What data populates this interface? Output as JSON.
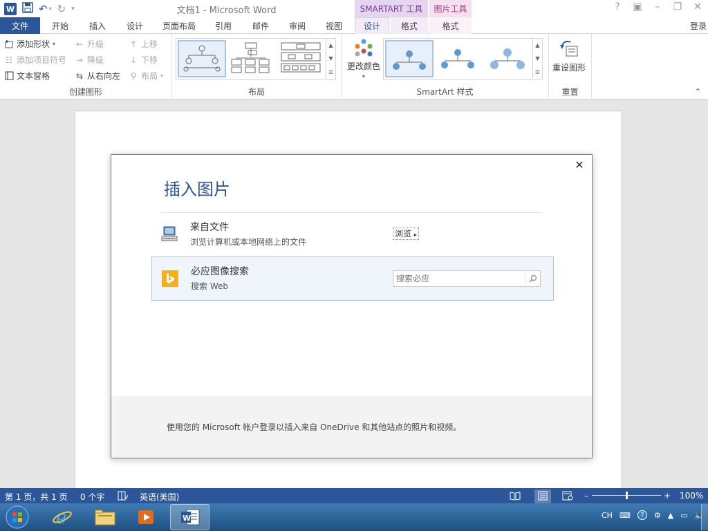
{
  "window": {
    "doc_title": "文档1 - Microsoft Word",
    "app_icon": "W"
  },
  "context_tools": {
    "smartart": "SMARTART 工具",
    "picture": "图片工具"
  },
  "tabs": [
    "文件",
    "开始",
    "插入",
    "设计",
    "页面布局",
    "引用",
    "邮件",
    "审阅",
    "视图",
    "设计",
    "格式",
    "格式"
  ],
  "login": "登录",
  "ribbon": {
    "create_graphic": {
      "label": "创建图形",
      "add_shape": "添加形状",
      "add_bullet": "添加项目符号",
      "text_pane": "文本窗格",
      "promote": "升级",
      "demote": "降级",
      "right_to_left": "从右向左",
      "move_up": "上移",
      "move_down": "下移",
      "layout": "布局"
    },
    "layouts": {
      "label": "布局"
    },
    "smartart_styles": {
      "label": "SmartArt 样式",
      "change_colors": "更改颜色"
    },
    "reset": {
      "label": "重置",
      "reset_graphic": "重设图形"
    }
  },
  "dialog": {
    "title": "插入图片",
    "from_file": {
      "title": "来自文件",
      "subtitle": "浏览计算机或本地网络上的文件",
      "browse": "浏览"
    },
    "bing": {
      "title": "必应图像搜索",
      "subtitle": "搜索 Web",
      "placeholder": "搜索必应"
    },
    "footer": "使用您的 Microsoft 帐户登录以插入来自 OneDrive 和其他站点的照片和视频。"
  },
  "status": {
    "page": "第 1 页，共 1 页",
    "words": "0 个字",
    "language": "英语(美国)",
    "zoom": "100%",
    "zoom_level": 0.5
  },
  "taskbar": {
    "tray_lang": "CH"
  },
  "colors": {
    "word_blue": "#2b579a",
    "smartart_accent": "#7d3a96",
    "picture_accent": "#a4378a"
  }
}
